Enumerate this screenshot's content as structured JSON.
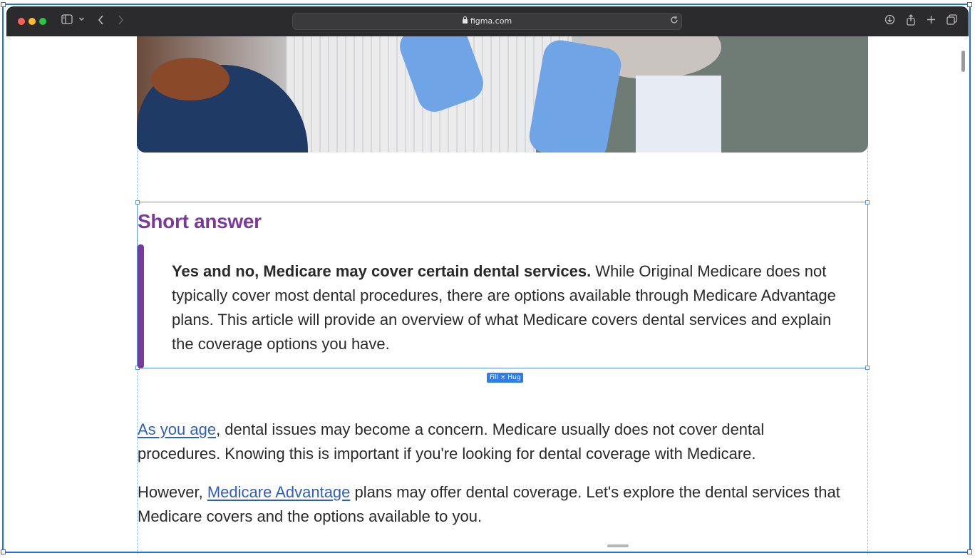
{
  "browser": {
    "url": "figma.com",
    "icons": {
      "sidebar": "sidebar-icon",
      "chevron": "chevron-down-icon",
      "back": "back-icon",
      "forward": "forward-icon",
      "lock": "lock-icon",
      "reload": "reload-icon",
      "download": "download-icon",
      "share": "share-icon",
      "new_tab": "plus-icon",
      "tabs": "tabs-overview-icon"
    }
  },
  "article": {
    "short_answer_heading": "Short answer",
    "quote_bold": "Yes and no, Medicare may cover certain dental services.",
    "quote_rest": " While Original Medicare does not typically cover most dental procedures, there are options available through Medicare Advantage plans. This article will provide an overview of what Medicare covers dental services and explain the coverage options you have.",
    "para1_link": "As you age",
    "para1_rest": ", dental issues may become a concern. Medicare usually does not cover dental procedures. Knowing this is important if you're looking for dental coverage with Medicare.",
    "para2_start": "However, ",
    "para2_link": "Medicare Advantage",
    "para2_rest": " plans may offer dental coverage. Let's explore the dental services that Medicare covers and the options available to you."
  },
  "editor": {
    "size_badge": "Fill × Hug"
  },
  "colors": {
    "accent_purple": "#7b3a98",
    "link_blue": "#2f5fb8",
    "selection_blue": "#2f7de6"
  }
}
